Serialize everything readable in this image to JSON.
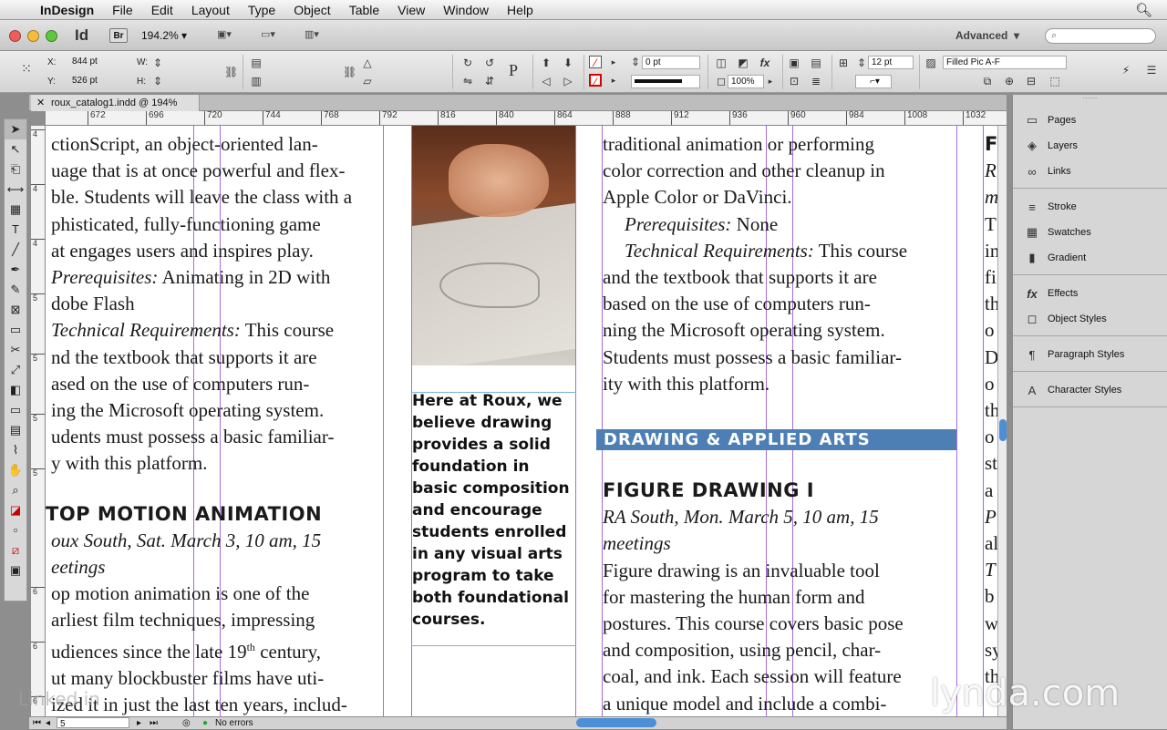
{
  "menubar": {
    "app": "InDesign",
    "items": [
      "File",
      "Edit",
      "Layout",
      "Type",
      "Object",
      "Table",
      "View",
      "Window",
      "Help"
    ]
  },
  "appbar": {
    "logo": "Id",
    "bridge": "Br",
    "zoom": "194.2%",
    "workspace": "Advanced"
  },
  "control": {
    "x_label": "X:",
    "x_value": "844 pt",
    "y_label": "Y:",
    "y_value": "526 pt",
    "w_label": "W:",
    "h_label": "H:",
    "stroke_weight": "0 pt",
    "opacity": "100%",
    "spacing": "12 pt",
    "object_style": "Filled Pic A-F"
  },
  "document": {
    "tab_title": "roux_catalog1.indd @ 194%",
    "page": "5",
    "preflight": "No errors"
  },
  "ruler": {
    "h_ticks": [
      "672",
      "696",
      "720",
      "744",
      "768",
      "792",
      "816",
      "840",
      "864",
      "888",
      "912",
      "936",
      "960",
      "984",
      "1008",
      "1032"
    ],
    "v_ticks": [
      "4",
      "4",
      "4",
      "5",
      "5",
      "5",
      "5",
      "6",
      "6",
      "6"
    ]
  },
  "left_column": {
    "lines": [
      "ctionScript, an object-oriented lan-",
      "uage that is at once powerful and flex-",
      "ble. Students will leave the class with a",
      "phisticated, fully-functioning game",
      "at engages users and inspires play."
    ],
    "prereq_label": "Prerequisites:",
    "prereq_text": " Animating in 2D with",
    "prereq_line2": "dobe Flash",
    "tech_label": "Technical Requirements:",
    "tech_text": " This course",
    "tech_lines": [
      "nd the textbook that supports it are",
      "ased on the use of computers run-",
      "ing the Microsoft operating system.",
      "udents must possess a basic familiar-",
      "y with this platform."
    ],
    "heading": "TOP MOTION ANIMATION",
    "meta1": "oux South, Sat. March 3, 10 am, 15",
    "meta2": "eetings",
    "body": [
      "op motion animation is one of the",
      "arliest film techniques, impressing",
      "udiences since the late 19",
      "ut many blockbuster films have uti-",
      "ized it in just the last ten years, includ-"
    ],
    "sup": "th",
    "century": " century,"
  },
  "caption": "Here at Roux, we believe drawing provides a solid foundation in basic composition and encourage students enrolled in any visual arts program to take both foundational courses.",
  "right_column": {
    "lines": [
      "traditional animation or performing",
      "color correction and other cleanup in",
      "Apple Color or DaVinci."
    ],
    "prereq_label": "Prerequisites:",
    "prereq_text": " None",
    "tech_label": "Technical Requirements:",
    "tech_text": " This course",
    "tech_lines": [
      "and the textbook that supports it are",
      "based on the use of computers run-",
      "ning the Microsoft operating system.",
      "Students must possess a basic familiar-",
      "ity with this platform."
    ],
    "band": "DRAWING & APPLIED ARTS",
    "heading": "FIGURE DRAWING I",
    "meta1": "RA South, Mon. March 5, 10 am, 15",
    "meta2": "meetings",
    "body": [
      "Figure drawing is an invaluable tool",
      "for mastering the human form and",
      "postures. This course covers basic pose",
      "and composition, using pencil, char-",
      "coal, and ink. Each session will feature",
      "a unique model and include a combi-"
    ]
  },
  "far_column": [
    "F",
    "R",
    "m",
    "T",
    "in",
    "fi",
    "th",
    "o",
    "D",
    "o",
    "th",
    "o",
    "st",
    "a",
    "P",
    "al",
    "T",
    "b",
    "w",
    "sy",
    "th"
  ],
  "panels": [
    {
      "items": [
        {
          "icon": "pages-icon",
          "glyph": "▭",
          "label": "Pages"
        },
        {
          "icon": "layers-icon",
          "glyph": "◈",
          "label": "Layers"
        },
        {
          "icon": "links-icon",
          "glyph": "∞",
          "label": "Links"
        }
      ]
    },
    {
      "items": [
        {
          "icon": "stroke-icon",
          "glyph": "≡",
          "label": "Stroke"
        },
        {
          "icon": "swatches-icon",
          "glyph": "▦",
          "label": "Swatches"
        },
        {
          "icon": "gradient-icon",
          "glyph": "▮",
          "label": "Gradient"
        }
      ]
    },
    {
      "items": [
        {
          "icon": "effects-icon",
          "glyph": "fx",
          "label": "Effects"
        },
        {
          "icon": "object-styles-icon",
          "glyph": "◻",
          "label": "Object Styles"
        }
      ]
    },
    {
      "items": [
        {
          "icon": "paragraph-styles-icon",
          "glyph": "¶",
          "label": "Paragraph Styles"
        }
      ]
    },
    {
      "items": [
        {
          "icon": "character-styles-icon",
          "glyph": "A",
          "label": "Character Styles"
        }
      ]
    }
  ],
  "watermark": "lynda.com",
  "linkedin": "Linked in"
}
